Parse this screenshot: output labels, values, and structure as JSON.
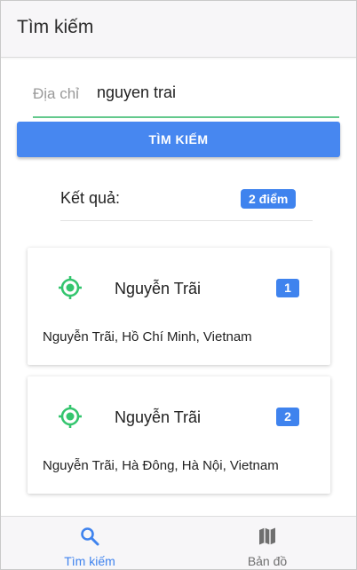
{
  "appbar": {
    "title": "Tìm kiếm"
  },
  "search": {
    "label": "Địa chỉ",
    "value": "nguyen trai",
    "button_label": "TÌM KIẾM"
  },
  "results": {
    "label": "Kết quả:",
    "count_badge": "2 điểm"
  },
  "cards": [
    {
      "name": "Nguyễn Trãi",
      "index": "1",
      "address": "Nguyễn Trãi, Hồ Chí Minh, Vietnam",
      "icon": "location-target-icon"
    },
    {
      "name": "Nguyễn Trãi",
      "index": "2",
      "address": "Nguyễn Trãi, Hà Đông, Hà Nội, Vietnam",
      "icon": "location-target-icon"
    }
  ],
  "bottom_nav": {
    "items": [
      {
        "label": "Tìm kiếm",
        "icon": "search-icon",
        "active": true
      },
      {
        "label": "Bản đồ",
        "icon": "map-icon",
        "active": false
      }
    ]
  },
  "colors": {
    "accent": "#4787f0",
    "badge": "#3f83ee",
    "field_underline": "#63c98c",
    "location_icon": "#34c56e",
    "nav_active": "#3f83ee",
    "nav_inactive": "#6f6f6f"
  }
}
